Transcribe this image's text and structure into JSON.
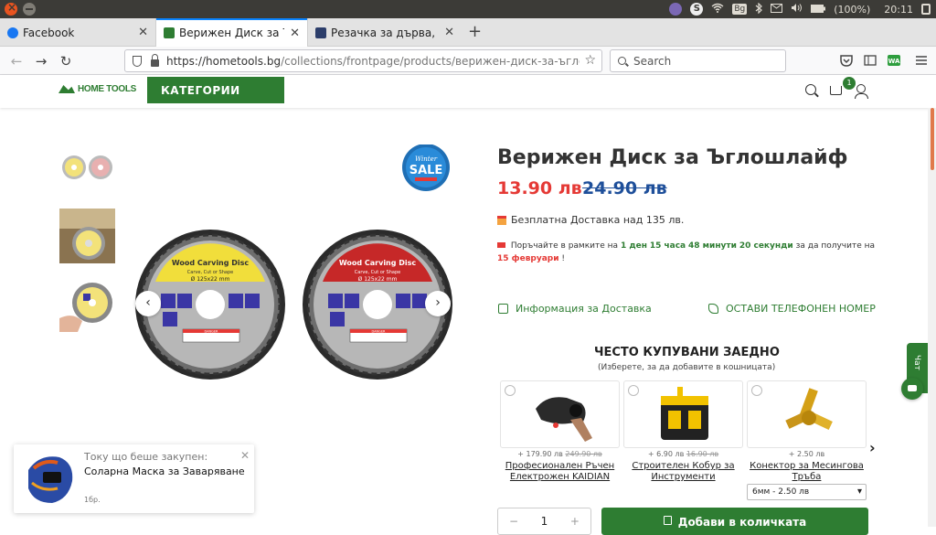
{
  "os": {
    "battery": "(100%)",
    "time": "20:11",
    "keyboard": "Bg"
  },
  "tabs": [
    {
      "title": "Facebook",
      "favicon_color": "#1877f2"
    },
    {
      "title": "Верижен Диск за Ъглошлайф",
      "favicon_color": "#2e7d32",
      "active": true
    },
    {
      "title": "Резачка за дърва, марка",
      "favicon_color": "#2c3e6b"
    }
  ],
  "nav": {
    "url_main": "https://hometools.bg",
    "url_path": "/collections/frontpage/products/верижен-диск-за-ъглошлайф?",
    "search_placeholder": "Search"
  },
  "site": {
    "logo": "HOME TOOLS",
    "categories": "КАТЕГОРИИ",
    "cart_count": "1",
    "accent": "#2e7d32"
  },
  "product": {
    "title": "Верижен Диск за Ъглошлайф",
    "price": "13.90 лв",
    "old_price": "24.90 лв",
    "shipping": "Безплатна Доставка над 135 лв.",
    "countdown": {
      "pre": "Поръчайте в рамките на",
      "days": "1 ден",
      "hours": "15 часа",
      "minutes": "48 минути",
      "seconds": "20 секунди",
      "mid": "за да получите на",
      "date": "15 февруари",
      "end": "!"
    },
    "badge": {
      "line1": "Winter",
      "line2": "SALE"
    },
    "disc_label": "Wood Carving Disc",
    "disc_sub": "Carve, Cut or Shape",
    "disc_size": "Ø 125x22 mm",
    "danger": "DANGER"
  },
  "links": {
    "delivery": "Информация за Доставка",
    "callback": "ОСТАВИ ТЕЛЕФОНЕН НОМЕР"
  },
  "fbt": {
    "title": "ЧЕСТО КУПУВАНИ ЗАЕДНО",
    "subtitle": "(Изберете, за да добавите в кошницата)",
    "items": [
      {
        "price": "+ 179.90 лв",
        "old": "249.90 лв",
        "name": "Професионален Ръчен Електрожен KAIDIAN"
      },
      {
        "price": "+ 6.90 лв",
        "old": "16.90 лв",
        "name": "Строителен Кобур за Инструменти"
      },
      {
        "price": "+ 2.50 лв",
        "old": "",
        "name": "Конектор за Месингова Тръба",
        "option": "6мм - 2.50 лв"
      }
    ]
  },
  "cart": {
    "qty": "1",
    "add_label": "Добави в количката",
    "minus": "−",
    "plus": "+"
  },
  "chat": {
    "label": "Чат"
  },
  "popup": {
    "line1": "Току що беше закупен:",
    "product": "Соларна Маска за Заваряване",
    "qty": "1бр."
  }
}
